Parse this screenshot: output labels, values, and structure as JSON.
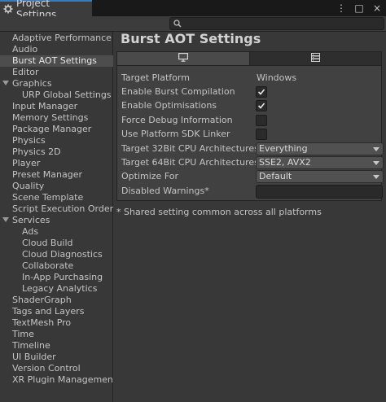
{
  "window": {
    "tab_title": "Project Settings",
    "controls": [
      "⋮",
      "□",
      "×"
    ]
  },
  "search": {
    "value": ""
  },
  "sidebar": {
    "items": [
      {
        "label": "Adaptive Performance",
        "level": 0
      },
      {
        "label": "Audio",
        "level": 0
      },
      {
        "label": "Burst AOT Settings",
        "level": 0,
        "selected": true
      },
      {
        "label": "Editor",
        "level": 0
      },
      {
        "label": "Graphics",
        "level": 0,
        "expanded": true
      },
      {
        "label": "URP Global Settings",
        "level": 1
      },
      {
        "label": "Input Manager",
        "level": 0
      },
      {
        "label": "Memory Settings",
        "level": 0
      },
      {
        "label": "Package Manager",
        "level": 0
      },
      {
        "label": "Physics",
        "level": 0
      },
      {
        "label": "Physics 2D",
        "level": 0
      },
      {
        "label": "Player",
        "level": 0
      },
      {
        "label": "Preset Manager",
        "level": 0
      },
      {
        "label": "Quality",
        "level": 0
      },
      {
        "label": "Scene Template",
        "level": 0
      },
      {
        "label": "Script Execution Order",
        "level": 0
      },
      {
        "label": "Services",
        "level": 0,
        "expanded": true
      },
      {
        "label": "Ads",
        "level": 1
      },
      {
        "label": "Cloud Build",
        "level": 1
      },
      {
        "label": "Cloud Diagnostics",
        "level": 1
      },
      {
        "label": "Collaborate",
        "level": 1
      },
      {
        "label": "In-App Purchasing",
        "level": 1
      },
      {
        "label": "Legacy Analytics",
        "level": 1
      },
      {
        "label": "ShaderGraph",
        "level": 0
      },
      {
        "label": "Tags and Layers",
        "level": 0
      },
      {
        "label": "TextMesh Pro",
        "level": 0
      },
      {
        "label": "Time",
        "level": 0
      },
      {
        "label": "Timeline",
        "level": 0
      },
      {
        "label": "UI Builder",
        "level": 0
      },
      {
        "label": "Version Control",
        "level": 0
      },
      {
        "label": "XR Plugin Management",
        "level": 0
      }
    ]
  },
  "main": {
    "title": "Burst AOT Settings",
    "platform_tabs": [
      {
        "icon": "monitor-icon",
        "active": true
      },
      {
        "icon": "server-icon",
        "active": false
      }
    ],
    "settings": {
      "target_platform": {
        "label": "Target Platform",
        "value": "Windows"
      },
      "enable_burst_compilation": {
        "label": "Enable Burst Compilation",
        "checked": true
      },
      "enable_optimisations": {
        "label": "Enable Optimisations",
        "checked": true
      },
      "force_debug_information": {
        "label": "Force Debug Information",
        "checked": false
      },
      "use_platform_sdk_linker": {
        "label": "Use Platform SDK Linker",
        "checked": false
      },
      "target_32bit_cpu": {
        "label": "Target 32Bit CPU Architectures",
        "value": "Everything"
      },
      "target_64bit_cpu": {
        "label": "Target 64Bit CPU Architectures",
        "value": "SSE2, AVX2"
      },
      "optimize_for": {
        "label": "Optimize For",
        "value": "Default"
      },
      "disabled_warnings": {
        "label": "Disabled Warnings*",
        "value": ""
      }
    },
    "note": "* Shared setting common across all platforms"
  },
  "colors": {
    "background": "#383838",
    "titlebar": "#191919",
    "tab_accent": "#3a79bb",
    "selected_item": "#4d4d4d",
    "panel": "#414141"
  }
}
